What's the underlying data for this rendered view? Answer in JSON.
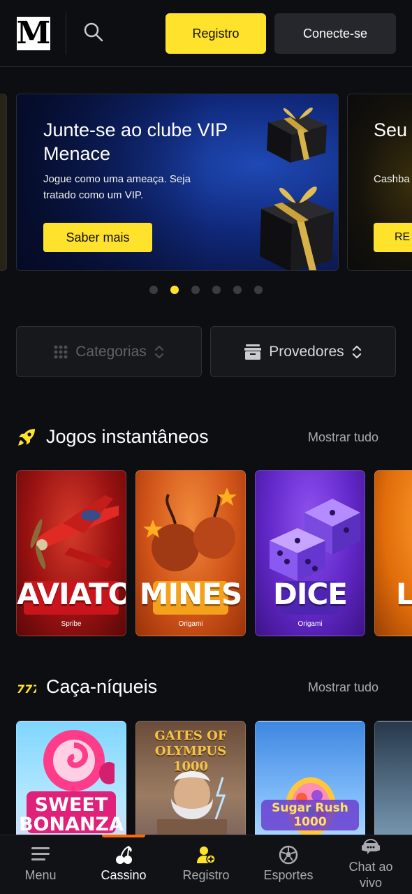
{
  "header": {
    "logo_text": "M",
    "register_label": "Registro",
    "login_label": "Conecte-se"
  },
  "carousel": {
    "slides": [
      {
        "title": "Junte-se ao clube VIP Menace",
        "subtitle": "Jogue como uma ameaça. Seja tratado como um VIP.",
        "button": "Saber mais"
      },
      {
        "title": "Seu refo",
        "subtitle": "Cashba Bônus",
        "button": "RE"
      }
    ],
    "active_index": 1,
    "dot_count": 6
  },
  "filters": {
    "categories_label": "Categorias",
    "providers_label": "Provedores"
  },
  "sections": {
    "instant": {
      "title": "Jogos instantâneos",
      "more": "Mostrar tudo",
      "games": [
        {
          "name": "AVIATOR",
          "provider": "Spribe"
        },
        {
          "name": "MINES",
          "provider": "Origami"
        },
        {
          "name": "DICE",
          "provider": "Origami"
        },
        {
          "name": "L",
          "provider": ""
        }
      ]
    },
    "slots": {
      "title": "Caça-níqueis",
      "more": "Mostrar tudo",
      "games": [
        {
          "name": "SWEET BONANZA"
        },
        {
          "name": "GATES OF OLYMPUS 1000"
        },
        {
          "name": "Sugar Rush 1000"
        },
        {
          "name": ""
        }
      ]
    }
  },
  "bottom_nav": {
    "items": [
      {
        "label": "Menu",
        "icon": "menu-icon"
      },
      {
        "label": "Cassino",
        "icon": "cherries-icon"
      },
      {
        "label": "Registro",
        "icon": "add-user-icon"
      },
      {
        "label": "Esportes",
        "icon": "soccer-ball-icon"
      },
      {
        "label": "Chat ao vivo",
        "icon": "chat-support-icon"
      }
    ],
    "active": "Cassino"
  },
  "colors": {
    "accent": "#ffe22b",
    "background": "#0d0e11",
    "nav_indicator": "#ff6a00"
  }
}
